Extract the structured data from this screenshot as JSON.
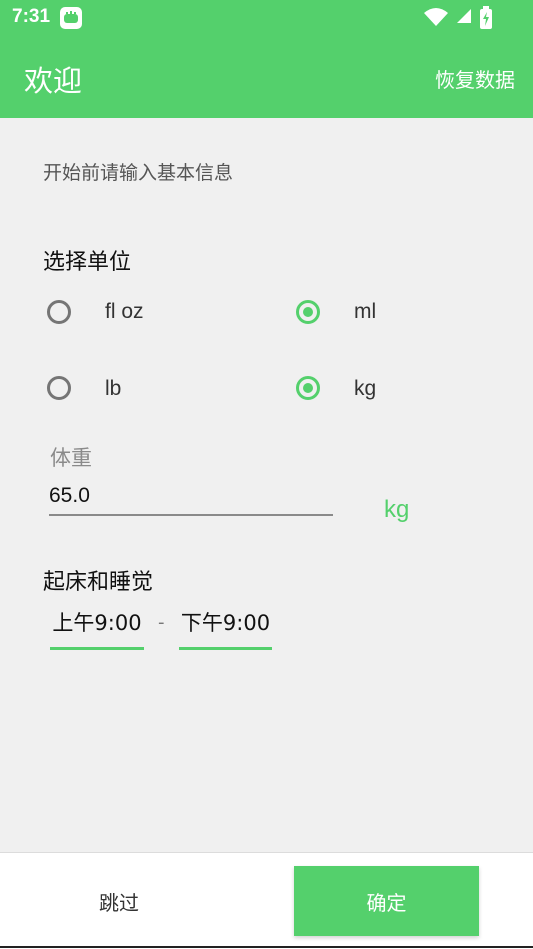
{
  "status_bar": {
    "time": "7:31",
    "icons": [
      "app-icon",
      "wifi-icon",
      "signal-icon",
      "battery-icon"
    ]
  },
  "app_bar": {
    "title": "欢迎",
    "action": "恢复数据"
  },
  "intro": "开始前请输入基本信息",
  "units": {
    "title": "选择单位",
    "volume_options": [
      "fl oz",
      "ml"
    ],
    "weight_options": [
      "lb",
      "kg"
    ],
    "selected_volume": "ml",
    "selected_weight": "kg"
  },
  "weight": {
    "label": "体重",
    "value": "65.0",
    "unit": "kg"
  },
  "wake_sleep": {
    "title": "起床和睡觉",
    "wake": "上午9:00",
    "separator": "-",
    "sleep": "下午9:00"
  },
  "buttons": {
    "skip": "跳过",
    "confirm": "确定"
  },
  "colors": {
    "accent": "#54d06c",
    "text": "#111111",
    "muted": "#8a8a8a"
  }
}
